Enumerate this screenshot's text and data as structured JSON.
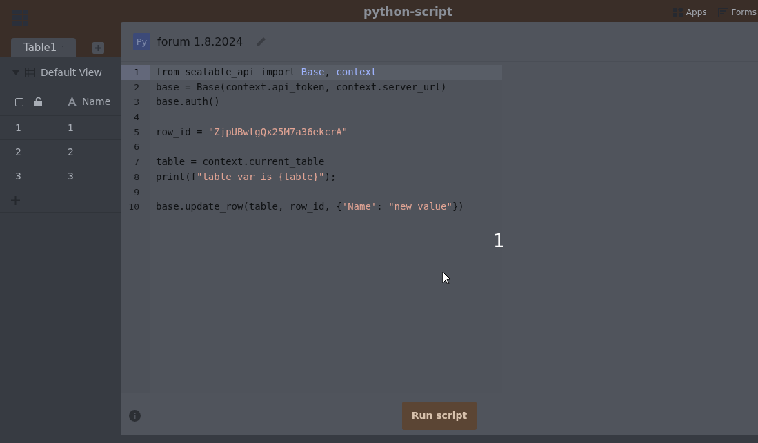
{
  "app": {
    "title": "python-script",
    "header_links": [
      {
        "label": "Apps",
        "kind": "apps"
      },
      {
        "label": "Forms",
        "kind": "forms"
      }
    ],
    "tabs": [
      {
        "label": "Table1",
        "selected": true
      }
    ],
    "view": {
      "label": "Default View"
    },
    "grid": {
      "select_all_checked": false,
      "columns": [
        "Name"
      ],
      "rows": [
        {
          "row_number": "1",
          "name": "1"
        },
        {
          "row_number": "2",
          "name": "2"
        },
        {
          "row_number": "3",
          "name": "3"
        }
      ]
    }
  },
  "dialog": {
    "badge": "Py",
    "title": "forum 1.8.2024",
    "code_lines": [
      {
        "number": "1",
        "active": true,
        "tokens": [
          {
            "text": "from seatable_api import ",
            "kind": "plain"
          },
          {
            "text": "Base",
            "kind": "name"
          },
          {
            "text": ", ",
            "kind": "plain"
          },
          {
            "text": "context",
            "kind": "name"
          }
        ]
      },
      {
        "number": "2",
        "active": false,
        "tokens": [
          {
            "text": "base = Base(context.api_token, context.server_url)",
            "kind": "plain"
          }
        ]
      },
      {
        "number": "3",
        "active": false,
        "tokens": [
          {
            "text": "base.auth()",
            "kind": "plain"
          }
        ]
      },
      {
        "number": "4",
        "active": false
      },
      {
        "number": "5",
        "active": false,
        "tokens": [
          {
            "text": "row_id = ",
            "kind": "plain"
          },
          {
            "text": "\"ZjpUBwtgQx25M7a36ekcrA\"",
            "kind": "string"
          }
        ]
      },
      {
        "number": "6",
        "active": false
      },
      {
        "number": "7",
        "active": false,
        "tokens": [
          {
            "text": "table = context.current_table",
            "kind": "plain"
          }
        ]
      },
      {
        "number": "8",
        "active": false,
        "tokens": [
          {
            "text": "print(f",
            "kind": "plain"
          },
          {
            "text": "\"table var is {table}\"",
            "kind": "string"
          },
          {
            "text": ");",
            "kind": "plain"
          }
        ]
      },
      {
        "number": "9",
        "active": false
      },
      {
        "number": "10",
        "active": false,
        "tokens": [
          {
            "text": "base.update_row(table, row_id, {",
            "kind": "plain"
          },
          {
            "text": "'Name'",
            "kind": "string"
          },
          {
            "text": ": ",
            "kind": "plain"
          },
          {
            "text": "\"new value\"",
            "kind": "string"
          },
          {
            "text": "})",
            "kind": "plain"
          }
        ]
      }
    ],
    "overlay_label": "1",
    "run_button": "Run script"
  }
}
